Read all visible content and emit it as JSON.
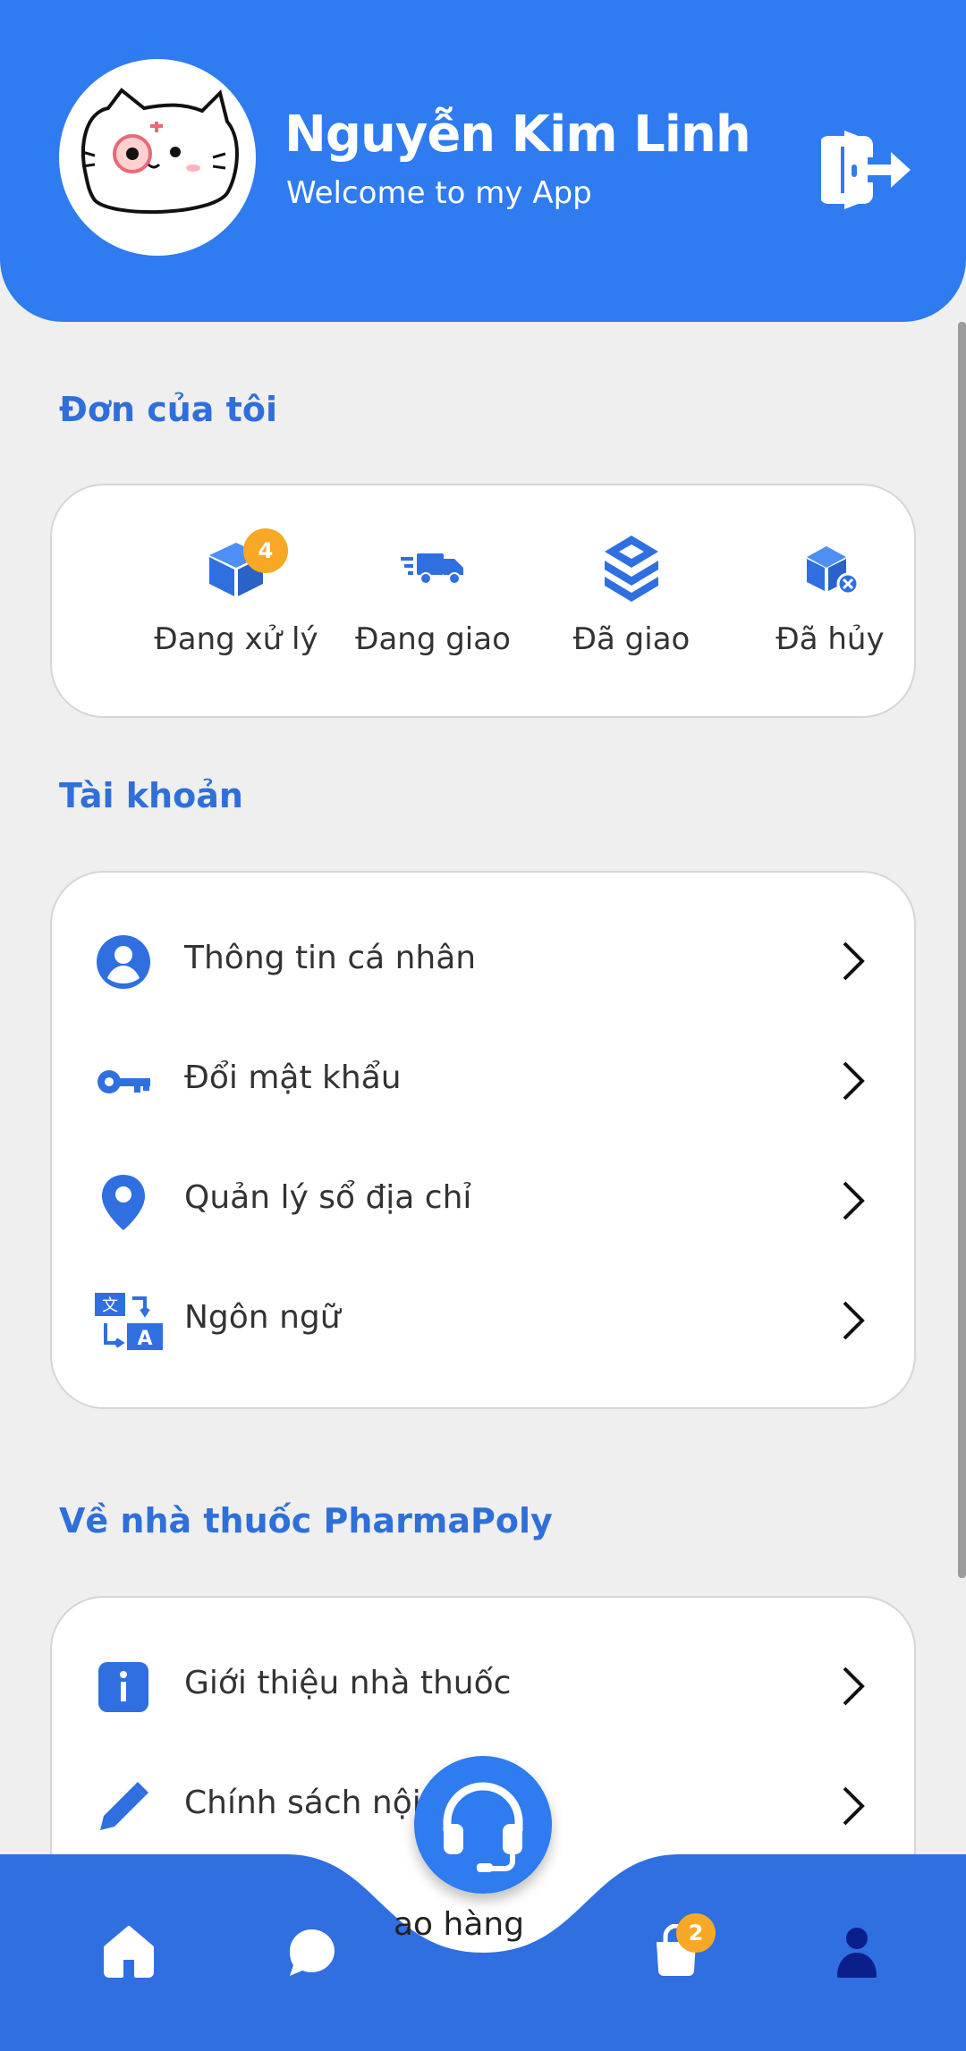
{
  "header": {
    "user_name": "Nguyễn Kim Linh",
    "welcome": "Welcome to my App",
    "avatar_icon": "cat-avatar",
    "logout_icon": "logout-icon"
  },
  "orders": {
    "title": "Đơn của tôi",
    "items": [
      {
        "label": "Đang xử lý",
        "icon": "box-icon",
        "badge": "4"
      },
      {
        "label": "Đang giao",
        "icon": "truck-icon"
      },
      {
        "label": "Đã giao",
        "icon": "delivered-box-icon"
      },
      {
        "label": "Đã hủy",
        "icon": "cancelled-box-icon"
      }
    ]
  },
  "account": {
    "title": "Tài khoản",
    "items": [
      {
        "label": "Thông tin cá nhân",
        "icon": "user-circle-icon"
      },
      {
        "label": "Đổi mật khẩu",
        "icon": "key-icon"
      },
      {
        "label": "Quản lý sổ địa chỉ",
        "icon": "location-pin-icon"
      },
      {
        "label": "Ngôn ngữ",
        "icon": "translate-icon"
      }
    ]
  },
  "about": {
    "title": "Về nhà thuốc PharmaPoly",
    "items": [
      {
        "label": "Giới thiệu nhà thuốc",
        "icon": "info-icon"
      },
      {
        "label": "Chính sách nội",
        "icon": "pencil-icon"
      }
    ]
  },
  "bottom_nav": {
    "partial_label": "ao hàng",
    "cart_badge": "2",
    "items": [
      "home-icon",
      "chat-icon",
      "support-headset-icon",
      "cart-bag-icon",
      "profile-icon"
    ]
  },
  "colors": {
    "primary": "#2f7bf0",
    "nav": "#2f6fe0",
    "section_title": "#2f6fd9",
    "badge": "#f7a826",
    "background": "#efefef"
  }
}
